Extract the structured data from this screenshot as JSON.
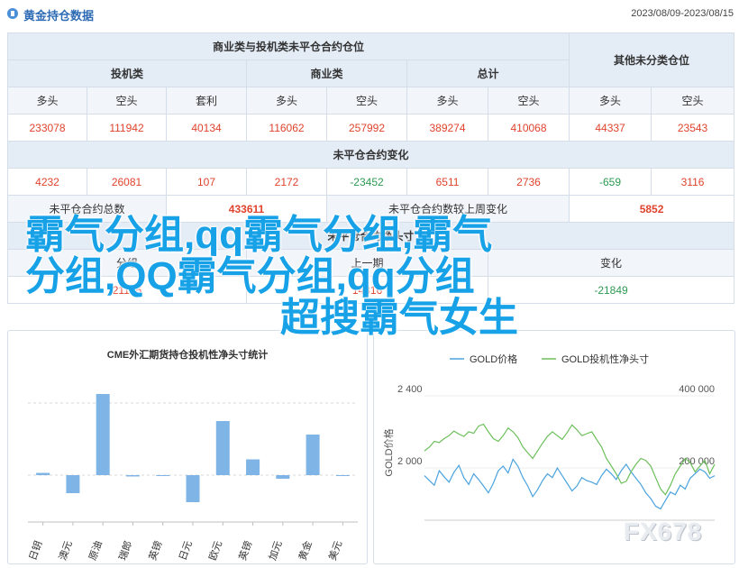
{
  "header": {
    "title": "黄金持仓数据",
    "date_range": "2023/08/09-2023/08/15"
  },
  "positions_table": {
    "group_title": "商业类与投机类未平仓合约仓位",
    "other_title": "其他未分类仓位",
    "sub_groups": [
      "投机类",
      "商业类",
      "总计"
    ],
    "columns": [
      "多头",
      "空头",
      "套利",
      "多头",
      "空头",
      "多头",
      "空头",
      "多头",
      "空头"
    ],
    "values": [
      "233078",
      "111942",
      "40134",
      "116062",
      "257992",
      "389274",
      "410068",
      "44337",
      "23543"
    ],
    "change_title": "未平仓合约变化",
    "change_values": [
      "4232",
      "26081",
      "107",
      "2172",
      "-23452",
      "6511",
      "2736",
      "-659",
      "3116"
    ],
    "oi_total_label": "未平仓合约总数",
    "oi_total_value": "433611",
    "oi_change_label": "未平仓合约数较上周变化",
    "oi_change_value": "5852",
    "net_title": "未平仓合约净头寸",
    "net_headers": [
      "分组",
      "上一期",
      "变化"
    ],
    "net_values": [
      "21136",
      "14316",
      "-21849"
    ]
  },
  "overlay": {
    "line1": "霸气分组,qq霸气分组,霸气",
    "line2": "分组,QQ霸气分组,qq分组",
    "line3": "超搜霸气女生"
  },
  "watermark": "FX678",
  "colors": {
    "positive": "#e0432d",
    "negative": "#2e9a52",
    "bar": "#7fb5e6",
    "gold_price": "#4aa3df",
    "gold_net_long": "#6cbf5a",
    "accent": "#2d6bb5"
  },
  "chart_data": [
    {
      "type": "bar",
      "title": "CME外汇期货持仓投机性净头寸统计",
      "categories": [
        "日钥",
        "澳元",
        "原油",
        "瑞郎",
        "英镑",
        "日元",
        "欧元",
        "英镑",
        "加元",
        "黄金",
        "美元"
      ],
      "values": [
        0.5,
        -4.0,
        18.0,
        -0.3,
        0.0,
        -6.0,
        12.0,
        3.5,
        -0.8,
        9.0,
        -0.2
      ],
      "ylim": [
        -8,
        22
      ]
    },
    {
      "type": "line",
      "title": "",
      "legend": [
        "GOLD价格",
        "GOLD投机性净头寸"
      ],
      "yleft_ticks": [
        "2 400",
        "2 000"
      ],
      "yright_ticks": [
        "400 000",
        "200 000"
      ],
      "ylabel": "GOLD价格",
      "x": [
        0,
        1,
        2,
        3,
        4,
        5,
        6,
        7,
        8,
        9,
        10,
        11,
        12,
        13,
        14,
        15,
        16,
        17,
        18,
        19,
        20,
        21,
        22,
        23,
        24,
        25,
        26,
        27,
        28,
        29,
        30,
        31,
        32,
        33,
        34,
        35,
        36,
        37,
        38,
        39,
        40,
        41,
        42,
        43,
        44,
        45,
        46,
        47,
        48,
        49,
        50,
        51,
        52,
        53,
        54,
        55,
        56,
        57,
        58,
        59
      ],
      "series": [
        {
          "name": "GOLD价格",
          "values": [
            1985,
            1972,
            1960,
            1998,
            1982,
            1968,
            1994,
            2012,
            1980,
            1962,
            1990,
            1975,
            1958,
            1940,
            1965,
            1998,
            2010,
            1992,
            2028,
            2010,
            1980,
            1958,
            1930,
            1948,
            1972,
            1990,
            1980,
            2005,
            1985,
            1965,
            1945,
            1958,
            1980,
            1972,
            1968,
            1962,
            1985,
            2002,
            1990,
            1975,
            1998,
            2015,
            1995,
            1978,
            1962,
            1940,
            1925,
            1905,
            1898,
            1920,
            1942,
            1935,
            1960,
            1950,
            1978,
            1990,
            2002,
            1995,
            1978,
            1985
          ]
        },
        {
          "name": "GOLD投机性净头寸",
          "values": [
            2050,
            2060,
            2075,
            2072,
            2082,
            2090,
            2102,
            2094,
            2088,
            2100,
            2096,
            2115,
            2120,
            2100,
            2082,
            2075,
            2090,
            2110,
            2100,
            2085,
            2060,
            2045,
            2030,
            2050,
            2070,
            2088,
            2100,
            2090,
            2080,
            2098,
            2118,
            2105,
            2090,
            2095,
            2100,
            2080,
            2060,
            2030,
            2010,
            1990,
            1965,
            1970,
            1995,
            2015,
            2030,
            2025,
            2010,
            1980,
            1950,
            1935,
            1960,
            1990,
            2010,
            2030,
            2020,
            1995,
            2010,
            2025,
            1990,
            2015
          ]
        }
      ]
    }
  ]
}
